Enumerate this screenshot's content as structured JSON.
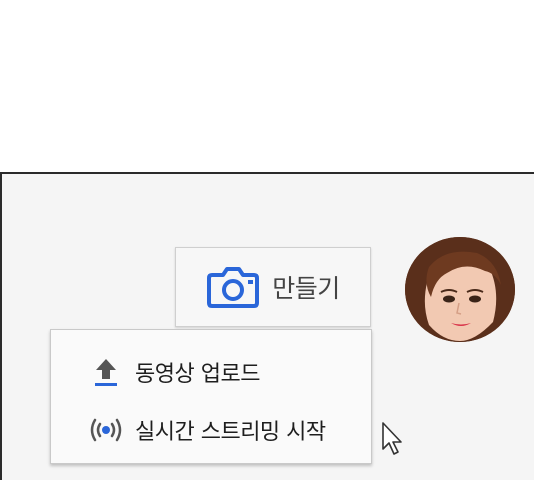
{
  "create_button": {
    "label": "만들기",
    "icon": "camera-icon"
  },
  "menu": {
    "items": [
      {
        "label": "동영상 업로드",
        "icon": "upload-icon"
      },
      {
        "label": "실시간 스트리밍 시작",
        "icon": "live-stream-icon"
      }
    ]
  },
  "colors": {
    "accent": "#2a66d9",
    "text": "#1e1e1e",
    "button_text": "#444444"
  }
}
